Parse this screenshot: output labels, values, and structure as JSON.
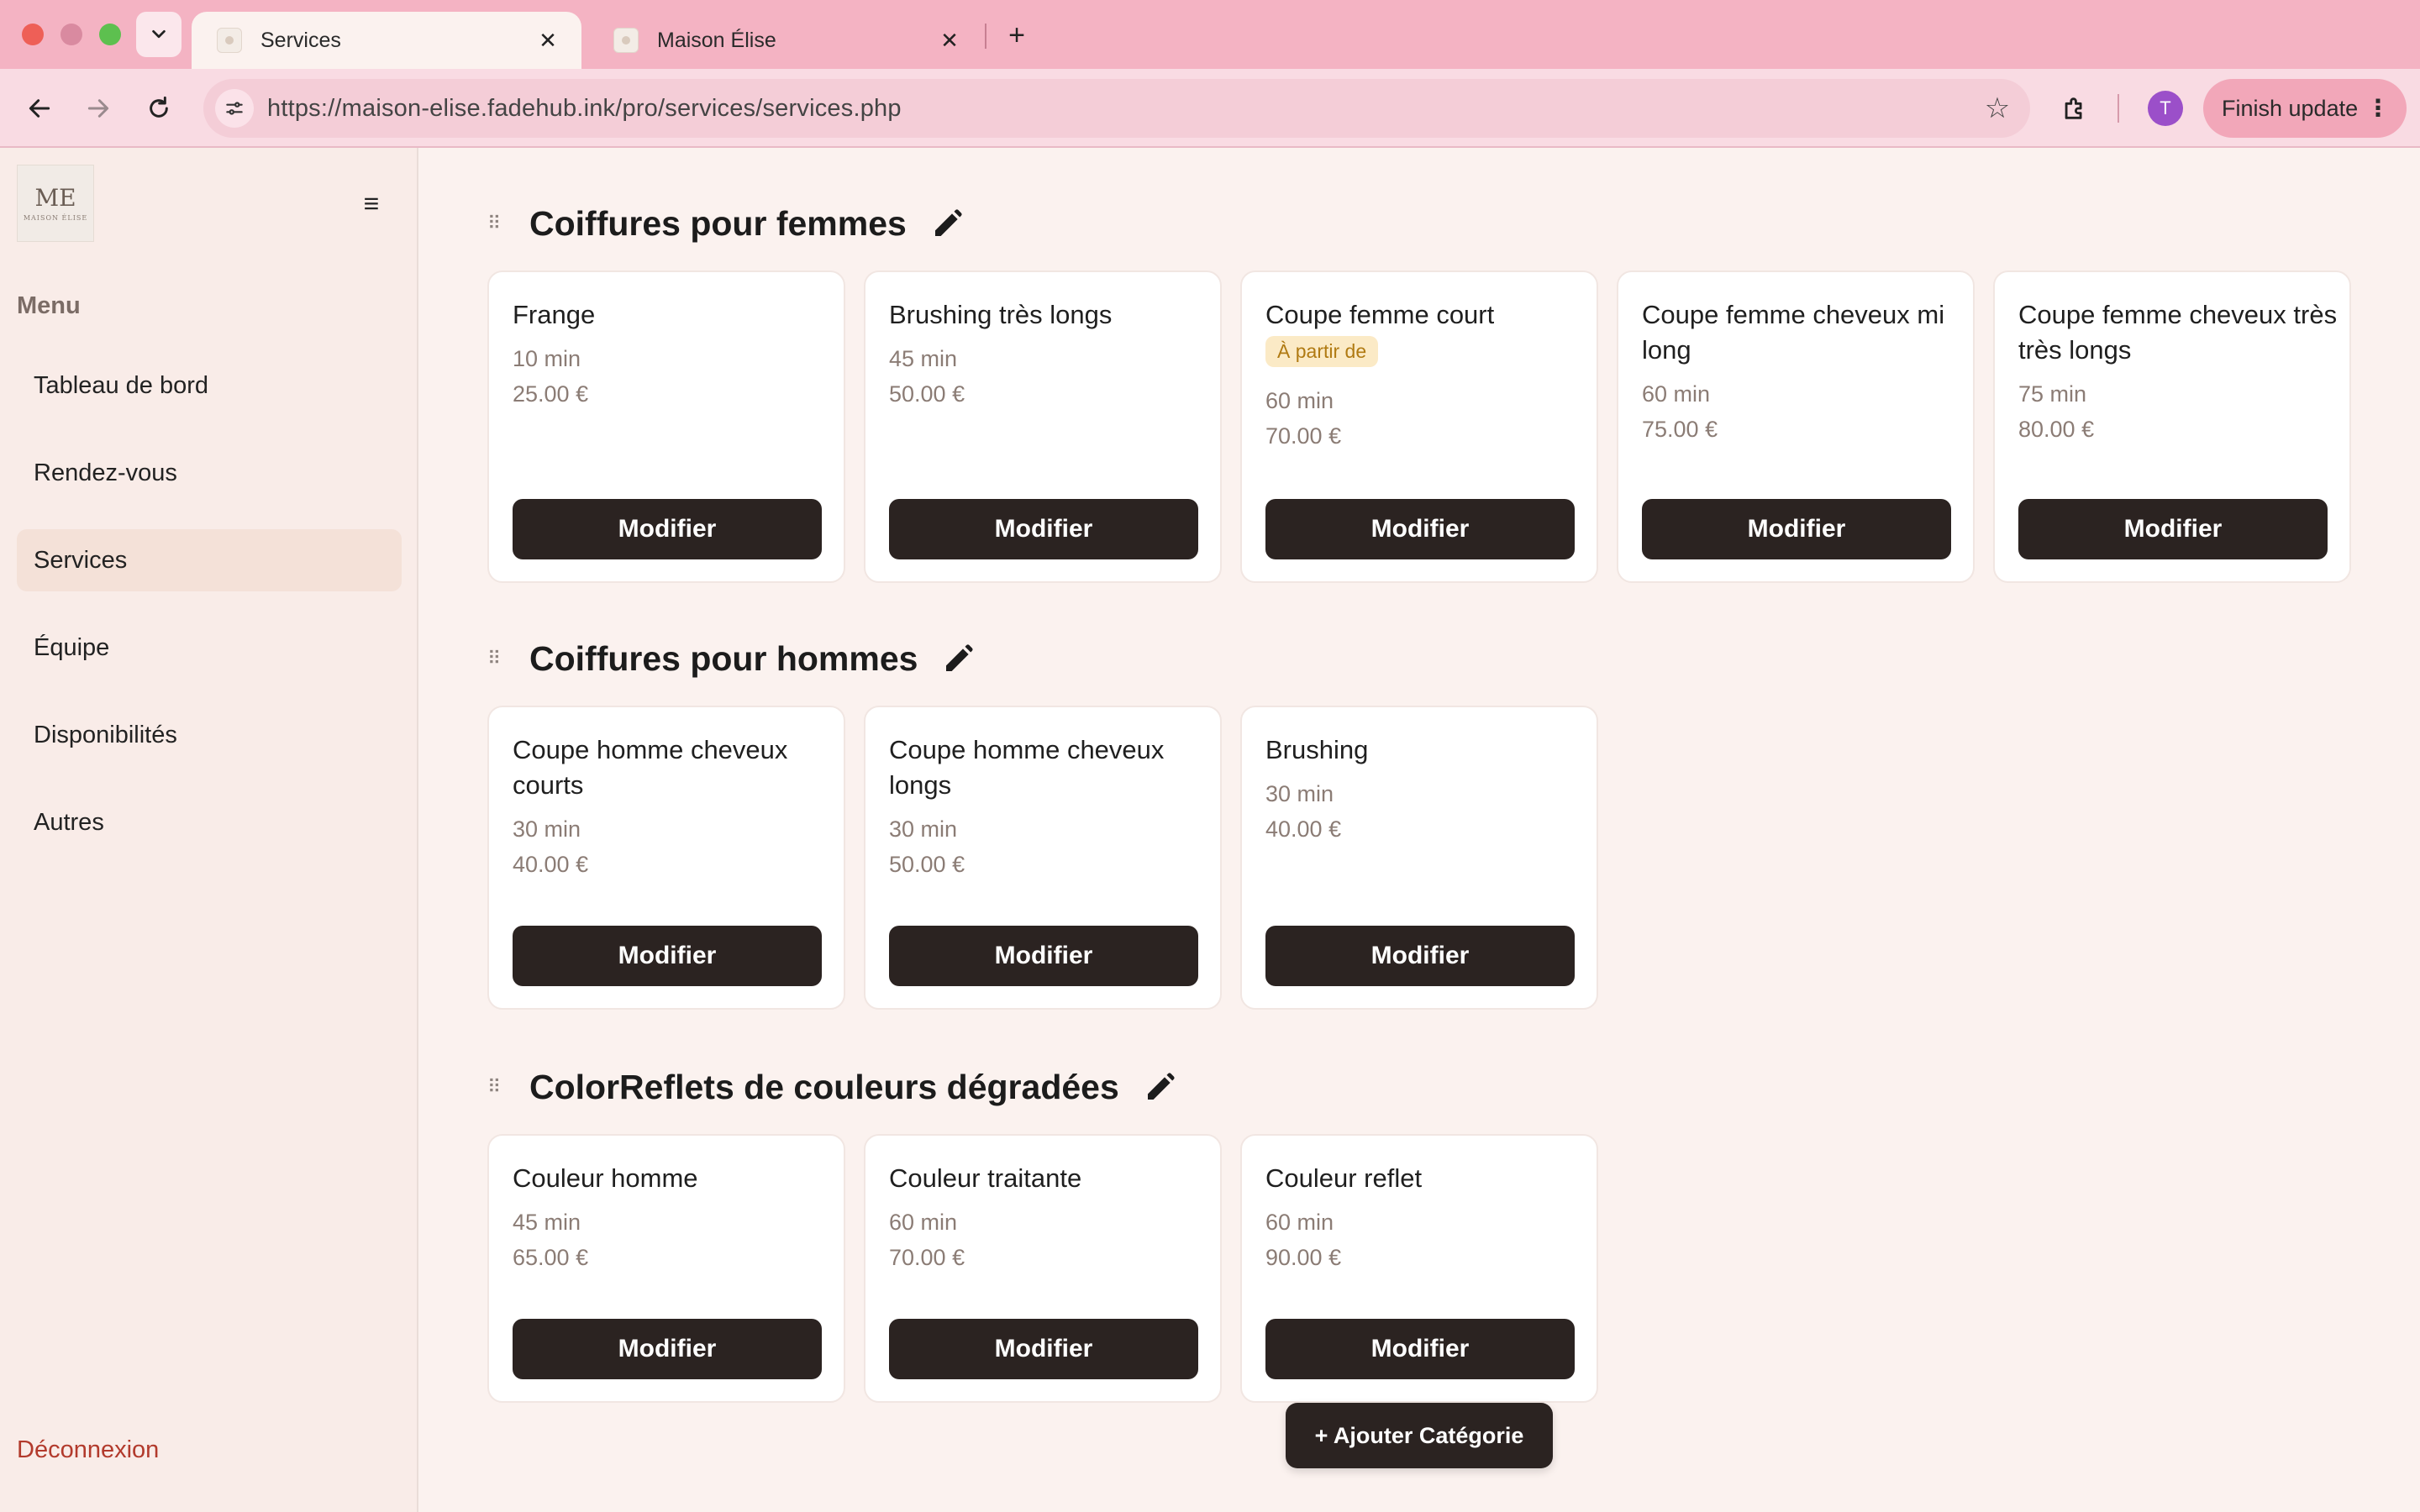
{
  "browser": {
    "tabs": [
      {
        "title": "Services",
        "active": true
      },
      {
        "title": "Maison Élise",
        "active": false
      }
    ],
    "url": "https://maison-elise.fadehub.ink/pro/services/services.php",
    "profile_initial": "T",
    "update_label": "Finish update",
    "colors": {
      "tabbar": "#f4b3c3",
      "toolbar": "#f9dbe3"
    }
  },
  "sidebar": {
    "logo": {
      "mark": "ME",
      "wordmark": "MAISON ÉLISE"
    },
    "menu_title": "Menu",
    "items": [
      {
        "label": "Tableau de bord",
        "active": false
      },
      {
        "label": "Rendez-vous",
        "active": false
      },
      {
        "label": "Services",
        "active": true
      },
      {
        "label": "Équipe",
        "active": false
      },
      {
        "label": "Disponibilités",
        "active": false
      },
      {
        "label": "Autres",
        "active": false
      }
    ],
    "logout_label": "Déconnexion"
  },
  "categories": [
    {
      "title": "Coiffures pour femmes",
      "services": [
        {
          "name": "Frange",
          "badge": "",
          "duration": "10 min",
          "price": "25.00 €"
        },
        {
          "name": "Brushing très longs",
          "badge": "",
          "duration": "45 min",
          "price": "50.00 €"
        },
        {
          "name": "Coupe femme court",
          "badge": "À partir de",
          "duration": "60 min",
          "price": "70.00 €"
        },
        {
          "name": "Coupe femme cheveux mi long",
          "badge": "",
          "duration": "60 min",
          "price": "75.00 €"
        },
        {
          "name": "Coupe femme cheveux très très longs",
          "badge": "",
          "duration": "75 min",
          "price": "80.00 €"
        }
      ]
    },
    {
      "title": "Coiffures pour hommes",
      "services": [
        {
          "name": "Coupe homme cheveux courts",
          "badge": "",
          "duration": "30 min",
          "price": "40.00 €"
        },
        {
          "name": "Coupe homme cheveux longs",
          "badge": "",
          "duration": "30 min",
          "price": "50.00 €"
        },
        {
          "name": "Brushing",
          "badge": "",
          "duration": "30 min",
          "price": "40.00 €"
        }
      ]
    },
    {
      "title": "ColorReflets de couleurs dégradées",
      "services": [
        {
          "name": "Couleur homme",
          "badge": "",
          "duration": "45 min",
          "price": "65.00 €"
        },
        {
          "name": "Couleur traitante",
          "badge": "",
          "duration": "60 min",
          "price": "70.00 €"
        },
        {
          "name": "Couleur reflet",
          "badge": "",
          "duration": "60 min",
          "price": "90.00 €"
        }
      ]
    }
  ],
  "modify_label": "Modifier",
  "add_category_label": "+ Ajouter Catégorie",
  "colors": {
    "button": "#2b2321",
    "active_nav": "#f4e1d8",
    "badge_bg": "#fbeac6",
    "logout": "#b23a2c"
  }
}
